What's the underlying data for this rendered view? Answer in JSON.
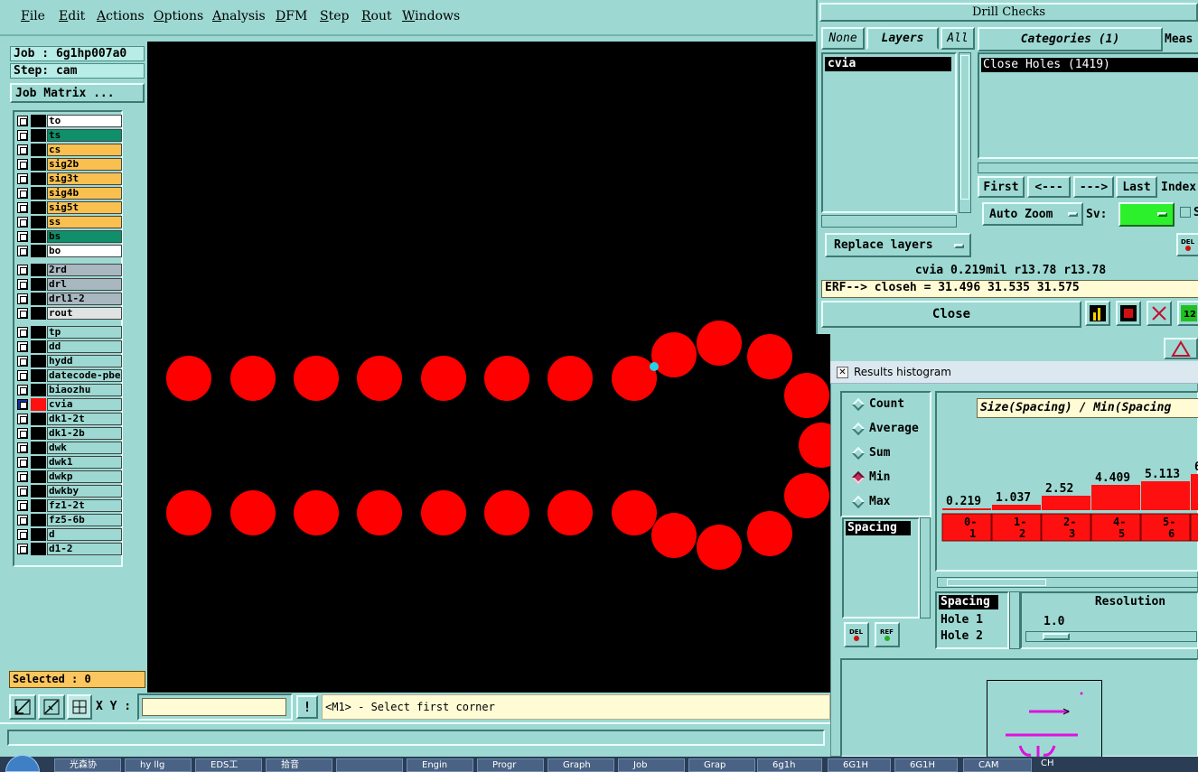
{
  "menu": [
    "File",
    "Edit",
    "Actions",
    "Options",
    "Analysis",
    "DFM",
    "Step",
    "Rout",
    "Windows"
  ],
  "left_panel": {
    "job": "Job : 6g1hp007a0",
    "step": "Step: cam",
    "job_matrix_button": "Job Matrix ...",
    "selected": "Selected : 0",
    "layers": [
      {
        "name": "to",
        "color": "#ffffff"
      },
      {
        "name": "ts",
        "color": "#0f8f6a"
      },
      {
        "name": "cs",
        "color": "#f9c04f"
      },
      {
        "name": "sig2b",
        "color": "#f9c04f"
      },
      {
        "name": "sig3t",
        "color": "#f9c04f"
      },
      {
        "name": "sig4b",
        "color": "#f9c04f"
      },
      {
        "name": "sig5t",
        "color": "#f9c04f"
      },
      {
        "name": "ss",
        "color": "#f9c04f"
      },
      {
        "name": "bs",
        "color": "#0f8f6a"
      },
      {
        "name": "bo",
        "color": "#ffffff"
      },
      {
        "name": "2rd",
        "color": "#a9b7c0"
      },
      {
        "name": "drl",
        "color": "#a9b7c0"
      },
      {
        "name": "drl1-2",
        "color": "#a9b7c0"
      },
      {
        "name": "rout",
        "color": "#dfe3e3"
      },
      {
        "name": "tp",
        "color": "#9dd9d2"
      },
      {
        "name": "dd",
        "color": "#9dd9d2"
      },
      {
        "name": "hydd",
        "color": "#9dd9d2"
      },
      {
        "name": "datecode-pbe",
        "color": "#9dd9d2"
      },
      {
        "name": "biaozhu",
        "color": "#9dd9d2"
      },
      {
        "name": "cvia",
        "color": "#9dd9d2",
        "active": true
      },
      {
        "name": "dk1-2t",
        "color": "#9dd9d2"
      },
      {
        "name": "dk1-2b",
        "color": "#9dd9d2"
      },
      {
        "name": "dwk",
        "color": "#9dd9d2"
      },
      {
        "name": "dwk1",
        "color": "#9dd9d2"
      },
      {
        "name": "dwkp",
        "color": "#9dd9d2"
      },
      {
        "name": "dwkby",
        "color": "#9dd9d2"
      },
      {
        "name": "fz1-2t",
        "color": "#9dd9d2"
      },
      {
        "name": "fz5-6b",
        "color": "#9dd9d2"
      },
      {
        "name": "d",
        "color": "#9dd9d2"
      },
      {
        "name": "d1-2",
        "color": "#9dd9d2"
      }
    ]
  },
  "bottom": {
    "xy_label": "X Y :",
    "xy_value": "",
    "prompt": "<M1> - Select first corner"
  },
  "drill_checks": {
    "title": "Drill Checks",
    "tabs": [
      "None",
      "Layers",
      "All"
    ],
    "categories_label": "Categories (1)",
    "meas_label": "Meas",
    "layers_list": [
      "cvia"
    ],
    "categories_list": [
      "Close Holes (1419)"
    ],
    "nav": [
      "First",
      "<---",
      "--->",
      "Last"
    ],
    "index_label": "Index",
    "auto_zoom": "Auto Zoom",
    "sv_label": "Sv:",
    "replace_layers": "Replace layers",
    "measure_line": "cvia 0.219mil  r13.78  r13.78",
    "erf_line": "ERF--> closeh = 31.496 31.535 31.575",
    "close_button": "Close",
    "s_label": "S"
  },
  "histogram": {
    "window_title": "Results histogram",
    "modes": [
      "Count",
      "Average",
      "Sum",
      "Min",
      "Max"
    ],
    "selected_mode": "Min",
    "chart_title": "Size(Spacing) / Min(Spacing",
    "bars": [
      {
        "value": "0.219",
        "label": "0-\n1"
      },
      {
        "value": "1.037",
        "label": "1-\n2"
      },
      {
        "value": "2.52",
        "label": "2-\n3"
      },
      {
        "value": "4.409",
        "label": "4-\n5"
      },
      {
        "value": "5.113",
        "label": "5-\n6"
      },
      {
        "value": "6",
        "label": ""
      }
    ],
    "list_items": [
      "Spacing"
    ],
    "attr_items": [
      "Spacing",
      "Hole 1",
      "Hole 2"
    ],
    "resolution_label": "Resolution",
    "resolution_value": "1.0"
  },
  "taskbar": [
    "光森协",
    "hy llg",
    "EDS工",
    "拾音",
    "",
    "Engin",
    "Progr",
    "Graph",
    "Job",
    "Grap",
    "6g1h",
    "6G1H",
    "6G1H",
    "CAM",
    "CH"
  ]
}
